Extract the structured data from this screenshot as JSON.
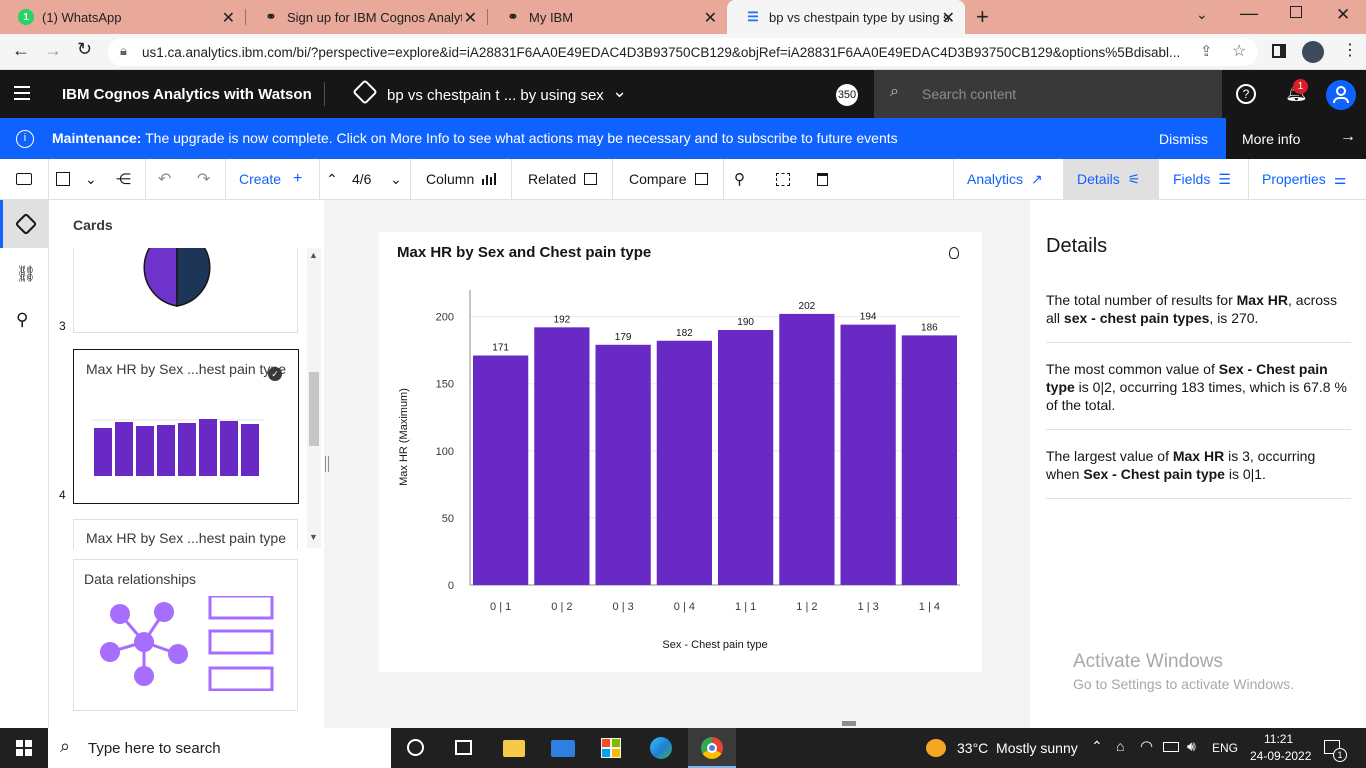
{
  "browser": {
    "tabs": [
      {
        "title": "(1) WhatsApp",
        "badge": "1"
      },
      {
        "title": "Sign up for IBM Cognos Analytic"
      },
      {
        "title": "My IBM"
      },
      {
        "title": "bp vs chestpain type by using se"
      }
    ],
    "url": "us1.ca.analytics.ibm.com/bi/?perspective=explore&id=iA28831F6AA0E49EDAC4D3B93750CB129&objRef=iA28831F6AA0E49EDAC4D3B93750CB129&options%5Bdisabl..."
  },
  "app": {
    "product": "IBM Cognos Analytics with Watson",
    "doc_title": "bp vs chestpain t ... by using sex",
    "avatar_count": "350",
    "search_placeholder": "Search content",
    "notif_count": "1"
  },
  "banner": {
    "lead": "Maintenance:",
    "text": "The upgrade is now complete. Click on More Info to see what actions may be necessary and to subscribe to future events",
    "dismiss": "Dismiss",
    "more": "More info"
  },
  "toolbar": {
    "create": "Create",
    "pager": "4/6",
    "column": "Column",
    "related": "Related",
    "compare": "Compare",
    "analytics": "Analytics",
    "details": "Details",
    "fields": "Fields",
    "properties": "Properties"
  },
  "cards": {
    "heading": "Cards",
    "card3_num": "3",
    "card4_title": "Max HR by Sex ...hest pain type",
    "card4_num": "4",
    "card5_title": "Max HR by Sex ...hest pain type",
    "relations_title": "Data relationships"
  },
  "chart": {
    "title": "Max HR by Sex and Chest pain type",
    "xlabel": "Sex - Chest pain type",
    "ylabel": "Max HR (Maximum)",
    "bar_color": "#6929c4"
  },
  "chart_data": {
    "type": "bar",
    "title": "Max HR by Sex and Chest pain type",
    "xlabel": "Sex - Chest pain type",
    "ylabel": "Max HR (Maximum)",
    "categories": [
      "0 | 1",
      "0 | 2",
      "0 | 3",
      "0 | 4",
      "1 | 1",
      "1 | 2",
      "1 | 3",
      "1 | 4"
    ],
    "values": [
      171,
      192,
      179,
      182,
      190,
      202,
      194,
      186
    ],
    "yticks": [
      0,
      50,
      100,
      150,
      200
    ],
    "ylim": [
      0,
      220
    ],
    "grid": true
  },
  "details": {
    "heading": "Details",
    "p1": [
      "The total number of results for ",
      "Max HR",
      ", across all ",
      "sex - chest pain types",
      ", is 270."
    ],
    "p2": [
      "The most common value of ",
      "Sex - Chest pain type",
      " is 0|2, occurring 183 times, which is 67.8 % of the total."
    ],
    "p3": [
      "The largest value of ",
      "Max HR",
      " is 3, occurring when ",
      "Sex - Chest pain type",
      " is 0|1."
    ],
    "watermark_title": "Activate Windows",
    "watermark_sub": "Go to Settings to activate Windows."
  },
  "taskbar": {
    "search": "Type here to search",
    "weather": "33°C  Mostly sunny",
    "lang": "ENG",
    "time": "11:21",
    "date": "24-09-2022",
    "notif": "1"
  }
}
